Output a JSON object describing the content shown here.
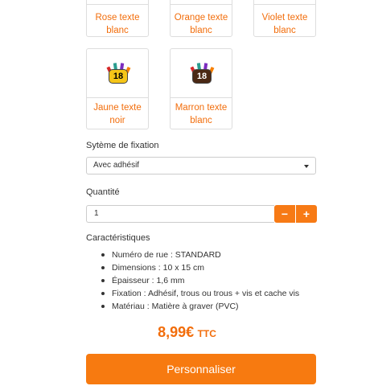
{
  "swatches_top": [
    {
      "label": "Rose texte blanc"
    },
    {
      "label": "Orange texte blanc"
    },
    {
      "label": "Violet texte blanc"
    }
  ],
  "swatches_bottom": [
    {
      "label": "Jaune texte noir",
      "plate_number": "18",
      "plate_bg": "#f5c518",
      "plate_text": "#000000"
    },
    {
      "label": "Marron texte blanc",
      "plate_number": "18",
      "plate_bg": "#4a2814",
      "plate_text": "#ffffff"
    }
  ],
  "fixation": {
    "label": "Sytème de fixation",
    "selected": "Avec adhésif"
  },
  "quantity": {
    "label": "Quantité",
    "value": "1",
    "minus": "−",
    "plus": "+"
  },
  "characteristics": {
    "title": "Caractéristiques",
    "items": [
      "Numéro de rue : STANDARD",
      "Dimensions : 10 x 15 cm",
      "Épaisseur : 1,6 mm",
      "Fixation : Adhésif, trous ou trous + vis et cache vis",
      "Matériau : Matière à graver (PVC)"
    ]
  },
  "price": {
    "amount": "8,99€",
    "suffix": "TTC"
  },
  "cta": {
    "label": "Personnaliser"
  },
  "colors": {
    "accent": "#f77a10",
    "link": "#f26d0b"
  }
}
